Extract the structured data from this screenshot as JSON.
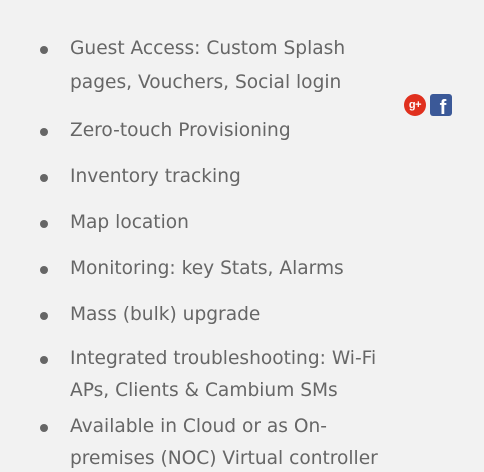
{
  "features": [
    {
      "lines": [
        "Guest Access: Custom Splash",
        "pages, Vouchers, Social login"
      ]
    },
    {
      "lines": [
        "Zero-touch Provisioning"
      ]
    },
    {
      "lines": [
        "Inventory tracking"
      ]
    },
    {
      "lines": [
        "Map location"
      ]
    },
    {
      "lines": [
        "Monitoring: key Stats, Alarms"
      ]
    },
    {
      "lines": [
        "Mass (bulk) upgrade"
      ]
    },
    {
      "lines": [
        "Integrated troubleshooting: Wi-Fi",
        "APs, Clients & Cambium SMs"
      ]
    },
    {
      "lines": [
        "Available in Cloud or as On-",
        "premises (NOC) Virtual controller"
      ]
    }
  ],
  "social_icons": {
    "google_plus": {
      "glyph": "g+",
      "icon": "google-plus-icon",
      "color": "#e0301e"
    },
    "facebook": {
      "glyph": "f",
      "icon": "facebook-icon",
      "color": "#3b5998"
    }
  }
}
